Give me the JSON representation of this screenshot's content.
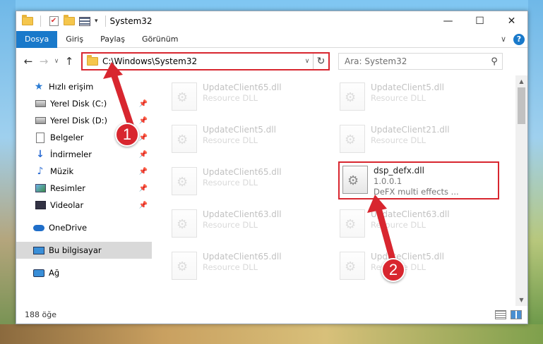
{
  "window": {
    "title": "System32",
    "minimize_glyph": "—",
    "maximize_glyph": "☐",
    "close_glyph": "✕"
  },
  "ribbon": {
    "tabs": [
      {
        "label": "Dosya",
        "active": true
      },
      {
        "label": "Giriş"
      },
      {
        "label": "Paylaş"
      },
      {
        "label": "Görünüm"
      }
    ],
    "expand_glyph": "∨",
    "help_glyph": "?"
  },
  "nav": {
    "back_glyph": "←",
    "forward_glyph": "→",
    "recent_glyph": "∨",
    "up_glyph": "↑",
    "address": "C:\\Windows\\System32",
    "address_drop_glyph": "∨",
    "refresh_glyph": "↻",
    "search_placeholder": "Ara: System32",
    "search_glyph": "⚲"
  },
  "sidebar": {
    "quick_access": {
      "label": "Hızlı erişim",
      "icon": "star-icon"
    },
    "pinned": [
      {
        "label": "Yerel Disk (C:)",
        "icon": "drive-icon"
      },
      {
        "label": "Yerel Disk (D:)",
        "icon": "drive-icon"
      },
      {
        "label": "Belgeler",
        "icon": "documents-icon"
      },
      {
        "label": "İndirmeler",
        "icon": "downloads-icon"
      },
      {
        "label": "Müzik",
        "icon": "music-icon"
      },
      {
        "label": "Resimler",
        "icon": "pictures-icon"
      },
      {
        "label": "Videolar",
        "icon": "videos-icon"
      }
    ],
    "pin_glyph": "📌",
    "onedrive": {
      "label": "OneDrive",
      "icon": "onedrive-icon"
    },
    "this_pc": {
      "label": "Bu bilgisayar",
      "icon": "computer-icon",
      "selected": true
    },
    "network": {
      "label": "Ağ",
      "icon": "network-icon"
    }
  },
  "files": [
    {
      "name": "UpdateClient65.dll",
      "sub": "Resource DLL"
    },
    {
      "name": "UpdateClient5.dll",
      "sub": "Resource DLL"
    },
    {
      "name": "UpdateClient5.dll",
      "sub": "Resource DLL"
    },
    {
      "name": "UpdateClient21.dll",
      "sub": "Resource DLL"
    },
    {
      "name": "UpdateClient65.dll",
      "sub": "Resource DLL"
    },
    {
      "name": "dsp_defx.dll",
      "version": "1.0.0.1",
      "description": "DeFX multi effects ...",
      "highlighted": true
    },
    {
      "name": "UpdateClient63.dll",
      "sub": "Resource DLL"
    },
    {
      "name": "UpdateClient63.dll",
      "sub": "Resource DLL"
    },
    {
      "name": "UpdateClient65.dll",
      "sub": "Resource DLL"
    },
    {
      "name": "UpdateClient5.dll",
      "sub": "Resource DLL"
    }
  ],
  "status": {
    "item_count": "188 öğe"
  },
  "annotations": [
    {
      "number": "1"
    },
    {
      "number": "2"
    }
  ],
  "colors": {
    "accent": "#1979ca",
    "highlight_red": "#d8262f"
  }
}
